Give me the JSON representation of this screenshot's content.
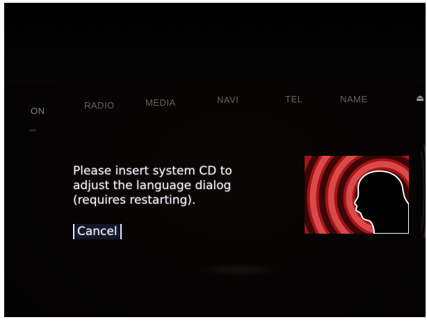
{
  "nav": {
    "items": [
      {
        "id": "on",
        "label": "ON"
      },
      {
        "id": "radio",
        "label": "RADIO"
      },
      {
        "id": "media",
        "label": "MEDIA"
      },
      {
        "id": "navi",
        "label": "NAVI"
      },
      {
        "id": "tel",
        "label": "TEL"
      },
      {
        "id": "name",
        "label": "NAME"
      }
    ],
    "eject_icon": "eject-icon",
    "eject_glyph": "⏏"
  },
  "dialog": {
    "lines": [
      "Please insert system CD to",
      "adjust the language dialog",
      "(requires restarting)."
    ],
    "cancel_label": "Cancel"
  },
  "voice_graphic": {
    "icon": "voice-head-icon",
    "colors": {
      "panel": "#a61416",
      "stripe_dark": "#3a0607",
      "stripe_light": "#d94a4a",
      "head": "#000000",
      "outline": "#ffffff"
    }
  },
  "colors": {
    "screen_bg": "#050303",
    "nav_text": "#6b625e",
    "dialog_text": "#f4f2f5",
    "button_border": "#e8e8ff"
  }
}
